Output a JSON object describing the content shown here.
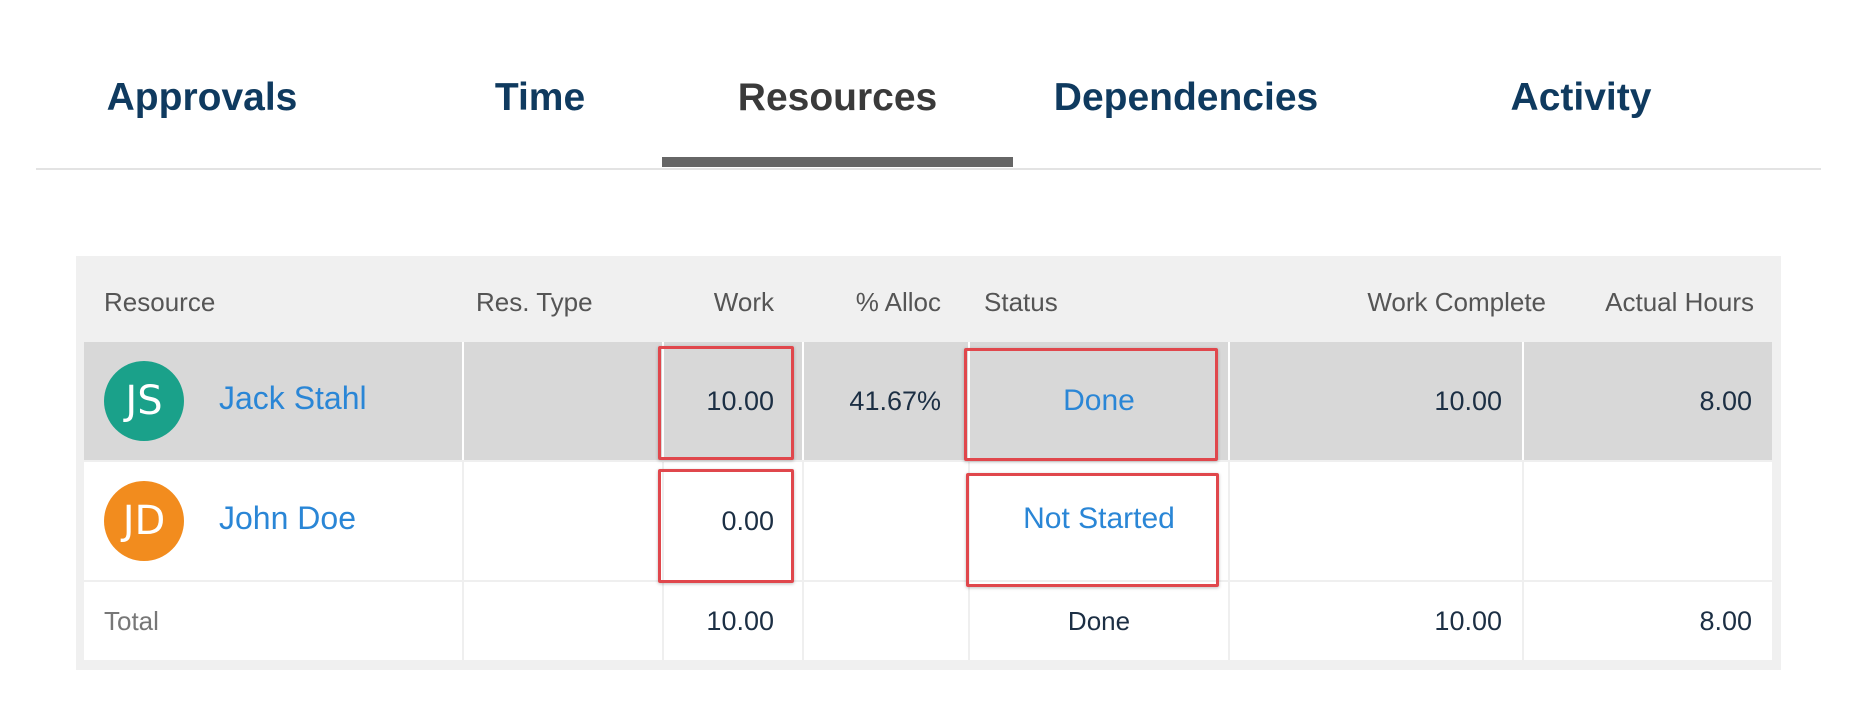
{
  "tabs": [
    {
      "label": "Approvals"
    },
    {
      "label": "Time"
    },
    {
      "label": "Resources"
    },
    {
      "label": "Dependencies"
    },
    {
      "label": "Activity"
    }
  ],
  "active_tab": "Resources",
  "table": {
    "headers": {
      "resource": "Resource",
      "res_type": "Res. Type",
      "work": "Work",
      "alloc": "% Alloc",
      "status": "Status",
      "work_complete": "Work Complete",
      "actual_hours": "Actual Hours"
    },
    "rows": [
      {
        "initials": "JS",
        "avatar_color": "#1aa18a",
        "name": "Jack Stahl",
        "res_type": "",
        "work": "10.00",
        "alloc": "41.67%",
        "status": "Done",
        "work_complete": "10.00",
        "actual_hours": "8.00"
      },
      {
        "initials": "JD",
        "avatar_color": "#f28c1e",
        "name": "John Doe",
        "res_type": "",
        "work": "0.00",
        "alloc": "",
        "status": "Not Started",
        "work_complete": "",
        "actual_hours": ""
      }
    ],
    "total": {
      "label": "Total",
      "work": "10.00",
      "status": "Done",
      "work_complete": "10.00",
      "actual_hours": "8.00"
    }
  },
  "colors": {
    "highlight_box": "#e0474c",
    "link": "#2a86d6",
    "tab_text": "#0f3a5f"
  }
}
